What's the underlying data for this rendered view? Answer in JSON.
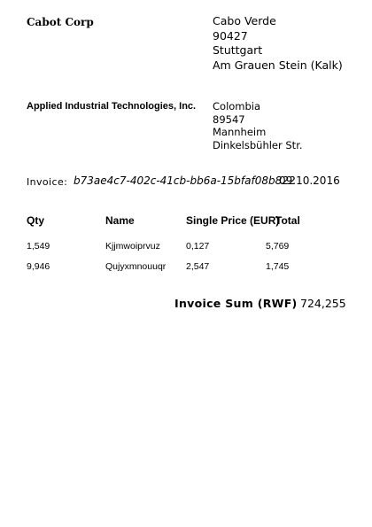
{
  "sender": {
    "name": "Cabot Corp",
    "country": "Cabo Verde",
    "postal_code": "90427",
    "city": "Stuttgart",
    "street": "Am Grauen Stein (Kalk)"
  },
  "recipient": {
    "name": "Applied Industrial Technologies, Inc.",
    "country": "Colombia",
    "postal_code": "89547",
    "city": "Mannheim",
    "street": "Dinkelsbühler Str."
  },
  "invoice": {
    "label": "Invoice:",
    "id": "b73ae4c7-402c-41cb-bb6a-15bfaf08b822",
    "date": "09.10.2016"
  },
  "table": {
    "headers": [
      "Qty",
      "Name",
      "Single Price (EUR)",
      "Total"
    ],
    "rows": [
      [
        "1,549",
        "Kjjmwoiprvuz",
        "0,127",
        "5,769"
      ],
      [
        "9,946",
        "Qujyxmnouuqr",
        "2,547",
        "1,745"
      ]
    ]
  },
  "sum": {
    "label": "Invoice Sum (RWF)",
    "value": "724,255"
  }
}
